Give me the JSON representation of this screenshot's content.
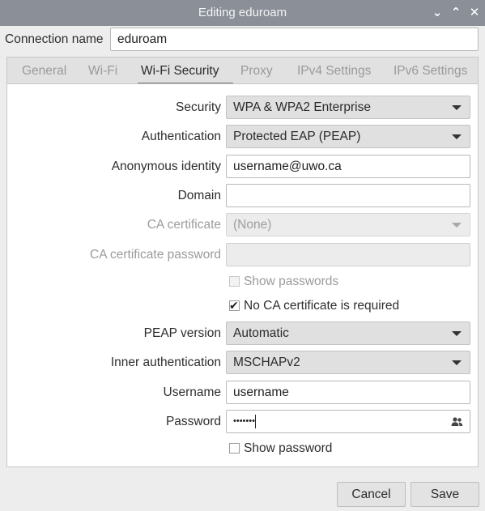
{
  "window": {
    "title": "Editing eduroam"
  },
  "connection": {
    "label": "Connection name",
    "value": "eduroam"
  },
  "tabs": [
    {
      "label": "General"
    },
    {
      "label": "Wi-Fi"
    },
    {
      "label": "Wi-Fi Security",
      "active": true
    },
    {
      "label": "Proxy"
    },
    {
      "label": "IPv4 Settings"
    },
    {
      "label": "IPv6 Settings"
    }
  ],
  "form": {
    "security": {
      "label": "Security",
      "value": "WPA & WPA2 Enterprise"
    },
    "authentication": {
      "label": "Authentication",
      "value": "Protected EAP (PEAP)"
    },
    "anonymous_identity": {
      "label": "Anonymous identity",
      "value": "username@uwo.ca"
    },
    "domain": {
      "label": "Domain",
      "value": ""
    },
    "ca_certificate": {
      "label": "CA certificate",
      "value": "(None)",
      "disabled": true
    },
    "ca_certificate_password": {
      "label": "CA certificate password",
      "value": "",
      "disabled": true
    },
    "show_passwords": {
      "label": "Show passwords",
      "checked": false,
      "disabled": true
    },
    "no_ca_required": {
      "label": "No CA certificate is required",
      "checked": true
    },
    "peap_version": {
      "label": "PEAP version",
      "value": "Automatic"
    },
    "inner_authentication": {
      "label": "Inner authentication",
      "value": "MSCHAPv2"
    },
    "username": {
      "label": "Username",
      "value": "username"
    },
    "password": {
      "label": "Password",
      "value": "•••••••"
    },
    "show_password": {
      "label": "Show password",
      "checked": false
    }
  },
  "buttons": {
    "cancel": "Cancel",
    "save": "Save"
  },
  "icons": {
    "password_storage": "users-icon",
    "minimize": "chevron-down-icon",
    "maximize": "chevron-up-icon",
    "close": "close-icon"
  }
}
